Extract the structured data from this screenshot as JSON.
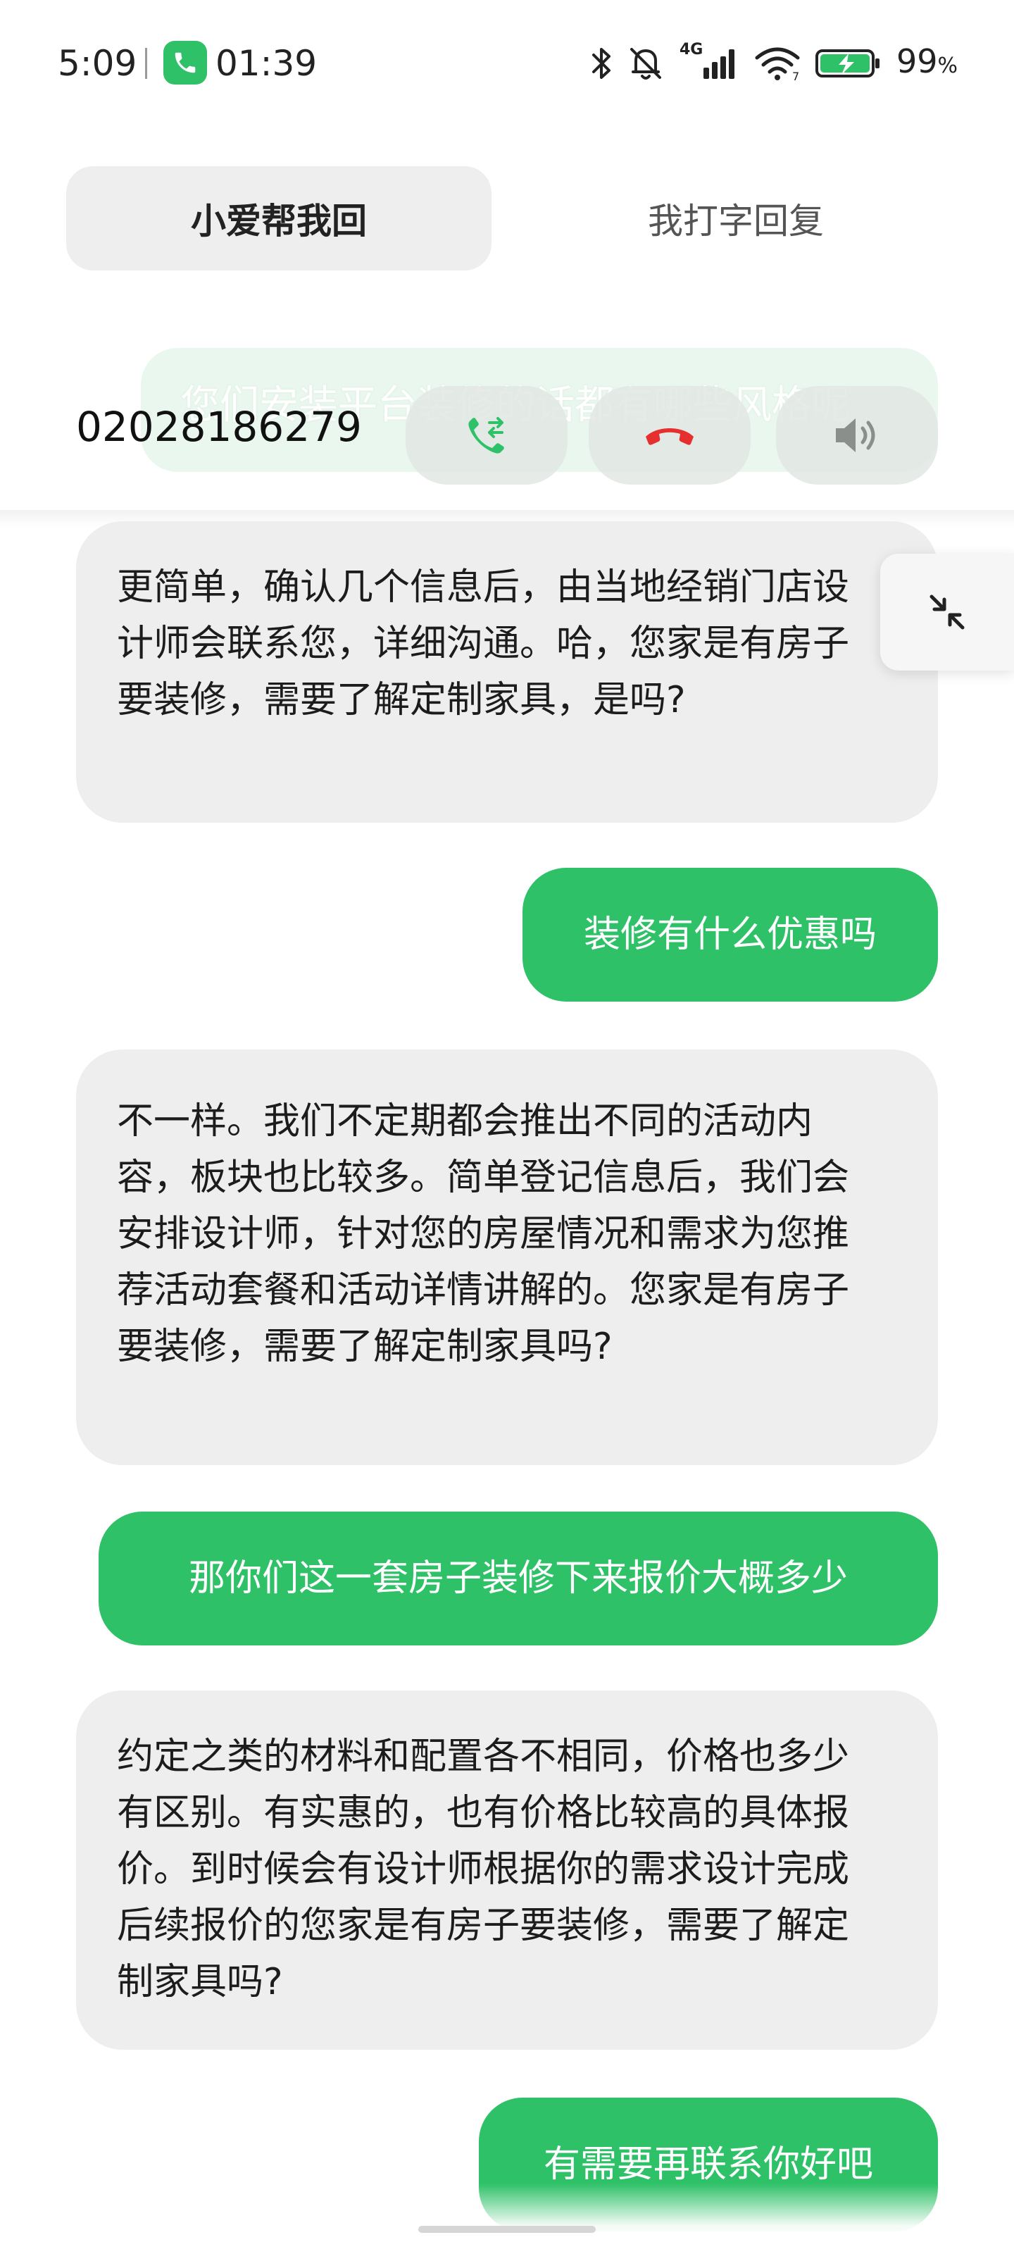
{
  "status_bar": {
    "time": "5:09",
    "call_timer": "01:39",
    "network": "4G",
    "battery_value": "99",
    "battery_unit": "%"
  },
  "tabs": {
    "active_label": "小爱帮我回",
    "inactive_label": "我打字回复"
  },
  "call": {
    "ghost_text": "您们安装平台装修的话都有哪些风格呢",
    "phone_number": "02028186279"
  },
  "messages": [
    {
      "role": "caller",
      "text": "更简单，确认几个信息后，由当地经销门店设计师会联系您，详细沟通。哈，您家是有房子要装修，需要了解定制家具，是吗?"
    },
    {
      "role": "user",
      "text": "装修有什么优惠吗"
    },
    {
      "role": "caller",
      "text": "不一样。我们不定期都会推出不同的活动内容，板块也比较多。简单登记信息后，我们会安排设计师，针对您的房屋情况和需求为您推荐活动套餐和活动详情讲解的。您家是有房子要装修，需要了解定制家具吗?"
    },
    {
      "role": "user",
      "text": "那你们这一套房子装修下来报价大概多少"
    },
    {
      "role": "caller",
      "text": "约定之类的材料和配置各不相同，价格也多少有区别。有实惠的，也有价格比较高的具体报价。到时候会有设计师根据你的需求设计完成后续报价的您家是有房子要装修，需要了解定制家具吗?"
    },
    {
      "role": "user",
      "text": "有需要再联系你好吧"
    }
  ],
  "colors": {
    "accent_green": "#2fc168",
    "hangup_red": "#e5302f",
    "incoming_bubble": "#eeeeee"
  },
  "icons": {
    "transfer": "phone-transfer-icon",
    "hangup": "hang-up-icon",
    "speaker": "speaker-icon",
    "collapse": "collapse-arrows-icon"
  }
}
